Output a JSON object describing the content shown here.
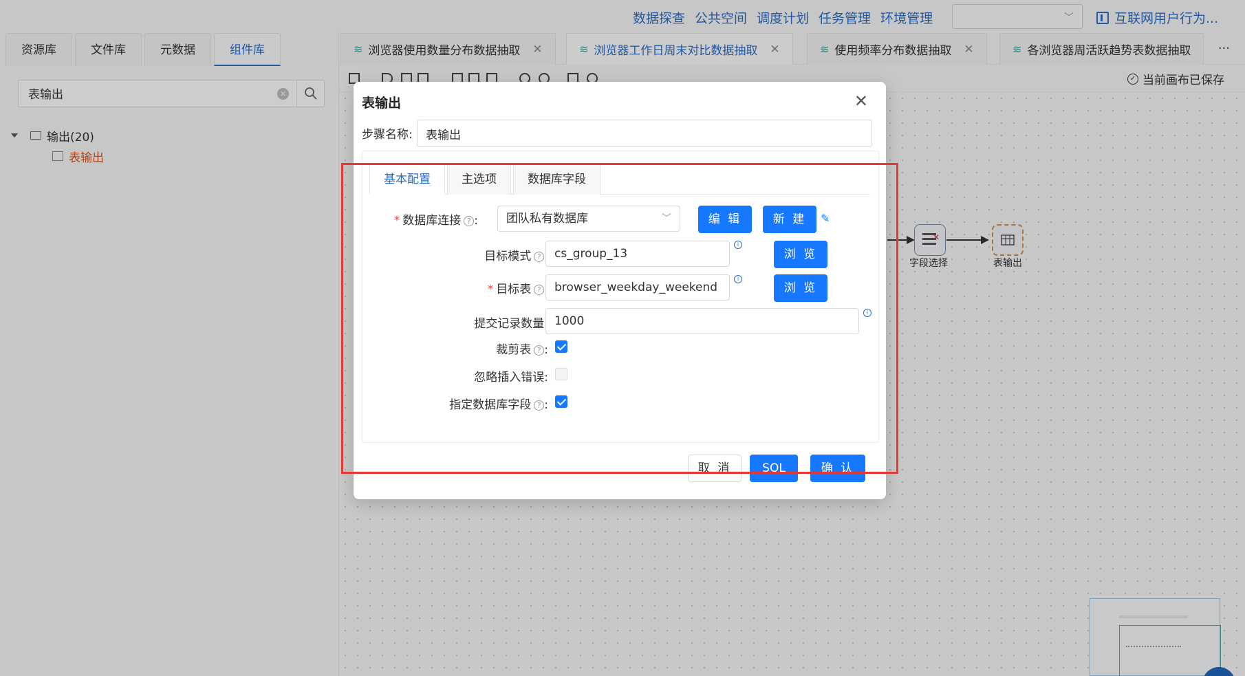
{
  "topnav": {
    "links": [
      "数据探查",
      "公共空间",
      "调度计划",
      "任务管理",
      "环境管理"
    ],
    "project": "互联网用户行为..."
  },
  "left": {
    "tabs": [
      "资源库",
      "文件库",
      "元数据",
      "组件库"
    ],
    "active_tab": "组件库",
    "search_value": "表输出",
    "tree": {
      "folder": "输出(20)",
      "child": "表输出"
    }
  },
  "filetabs": [
    {
      "label": "浏览器使用数量分布数据抽取"
    },
    {
      "label": "浏览器工作日周末对比数据抽取"
    },
    {
      "label": "使用频率分布数据抽取"
    },
    {
      "label": "各浏览器周活跃趋势表数据抽取"
    }
  ],
  "more": "···",
  "toolbar": {
    "saved": "当前画布已保存"
  },
  "flow": {
    "node1": "字段选择",
    "node2": "表输出"
  },
  "modal": {
    "title": "表输出",
    "step_label": "步骤名称:",
    "step_value": "表输出",
    "tabs": [
      "基本配置",
      "主选项",
      "数据库字段"
    ],
    "fields": {
      "db_conn_label": "数据库连接",
      "db_conn_value": "团队私有数据库",
      "schema_label": "目标模式",
      "schema_value": "cs_group_13",
      "table_label": "目标表",
      "table_value": "browser_weekday_weekend",
      "commit_label": "提交记录数量:",
      "commit_value": "1000",
      "truncate_label": "裁剪表",
      "ignore_label": "忽略插入错误:",
      "specify_label": "指定数据库字段"
    },
    "buttons": {
      "edit": "编 辑",
      "new": "新 建",
      "browse1": "浏 览",
      "browse2": "浏 览",
      "cancel": "取 消",
      "sql": "SQL",
      "ok": "确 认"
    }
  }
}
